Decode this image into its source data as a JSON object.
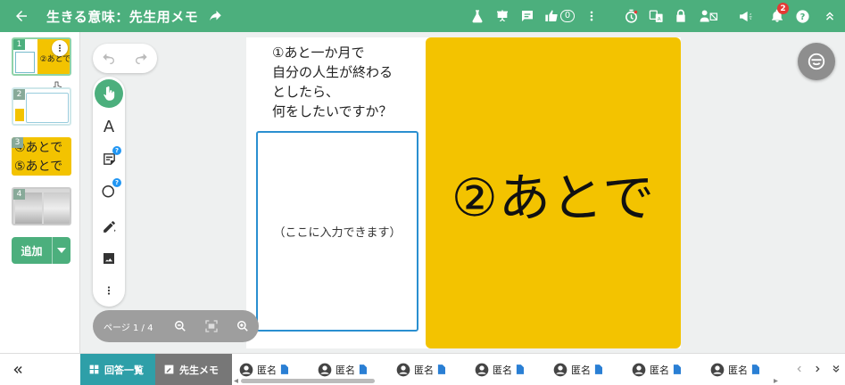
{
  "header": {
    "title": "生きる意味：先生用メモ",
    "like_count": "0",
    "notification_count": "2"
  },
  "sidebar": {
    "thumbnails": [
      {
        "num": "1",
        "text": "②あとで"
      },
      {
        "num": "2",
        "text": ""
      },
      {
        "num": "3",
        "lines": [
          "④あとで",
          "⑤あとで"
        ]
      },
      {
        "num": "4",
        "text": ""
      }
    ],
    "add_label": "追加"
  },
  "canvas": {
    "question": "①あと一か月で\n自分の人生が終わる\nとしたら、\n何をしたいですか？",
    "input_placeholder": "（ここに入力できます）",
    "big_text": "②あとで"
  },
  "pagebar": {
    "page_label": "ページ 1 / 4"
  },
  "bottom": {
    "answers_tab": "回答一覧",
    "memo_tab": "先生メモ",
    "students": [
      "匿名",
      "匿名",
      "匿名",
      "匿名",
      "匿名",
      "匿名",
      "匿名"
    ]
  },
  "colors": {
    "brand": "#4caf7d",
    "yellow": "#f3c300",
    "input_border": "#2a8fd0"
  }
}
